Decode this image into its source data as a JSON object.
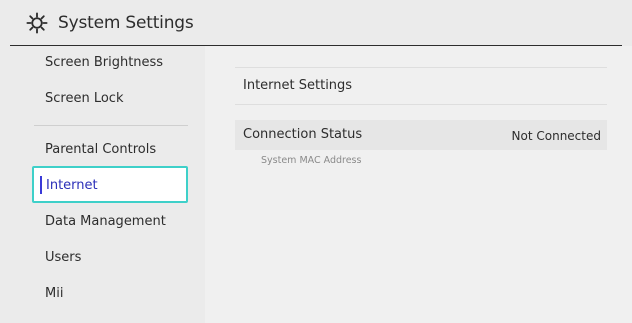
{
  "header": {
    "title": "System Settings",
    "icon": "gear-icon"
  },
  "sidebar": {
    "items": [
      {
        "label": "Screen Brightness"
      },
      {
        "label": "Screen Lock"
      },
      {
        "label": "Parental Controls"
      },
      {
        "label": "Internet",
        "selected": true
      },
      {
        "label": "Data Management"
      },
      {
        "label": "Users"
      },
      {
        "label": "Mii"
      }
    ]
  },
  "main": {
    "internet_settings_label": "Internet Settings",
    "connection_status": {
      "label": "Connection Status",
      "value": "Not Connected"
    },
    "mac_address_label": "System MAC Address"
  },
  "colors": {
    "selection_border": "#3ed0c9",
    "selection_marker": "#3a3ad8",
    "selected_text": "#2b2fb8",
    "background": "#ebebeb",
    "panel_background": "#f0f0f0"
  }
}
